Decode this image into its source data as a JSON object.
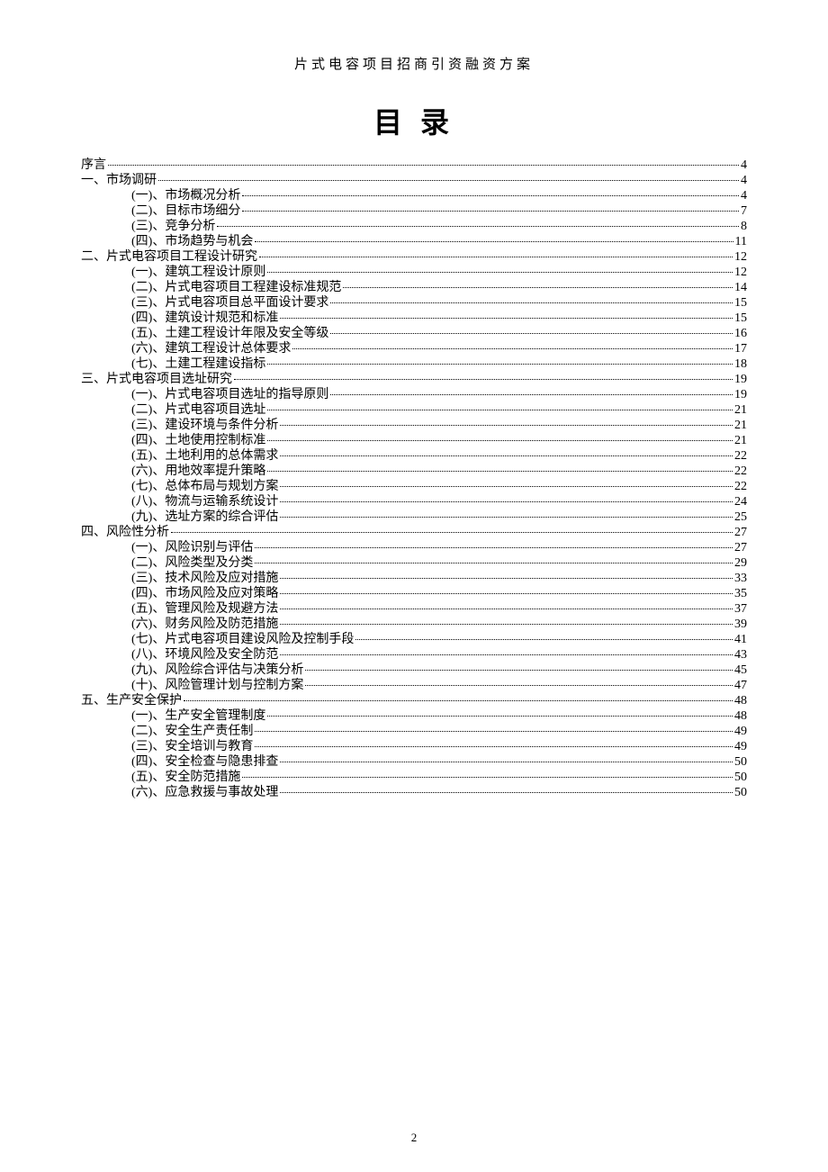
{
  "header": "片式电容项目招商引资融资方案",
  "title": "目 录",
  "page_number": "2",
  "toc": [
    {
      "level": 0,
      "label": "序言",
      "page": "4"
    },
    {
      "level": 1,
      "label": "一、市场调研",
      "page": "4"
    },
    {
      "level": 2,
      "label": "(一)、市场概况分析",
      "page": "4"
    },
    {
      "level": 2,
      "label": "(二)、目标市场细分",
      "page": "7"
    },
    {
      "level": 2,
      "label": "(三)、竞争分析",
      "page": "8"
    },
    {
      "level": 2,
      "label": "(四)、市场趋势与机会",
      "page": "11"
    },
    {
      "level": 1,
      "label": "二、片式电容项目工程设计研究",
      "page": "12"
    },
    {
      "level": 2,
      "label": "(一)、建筑工程设计原则",
      "page": "12"
    },
    {
      "level": 2,
      "label": "(二)、片式电容项目工程建设标准规范",
      "page": "14"
    },
    {
      "level": 2,
      "label": "(三)、片式电容项目总平面设计要求",
      "page": "15"
    },
    {
      "level": 2,
      "label": "(四)、建筑设计规范和标准",
      "page": "15"
    },
    {
      "level": 2,
      "label": "(五)、土建工程设计年限及安全等级",
      "page": "16"
    },
    {
      "level": 2,
      "label": "(六)、建筑工程设计总体要求",
      "page": "17"
    },
    {
      "level": 2,
      "label": "(七)、土建工程建设指标",
      "page": "18"
    },
    {
      "level": 1,
      "label": "三、片式电容项目选址研究",
      "page": "19"
    },
    {
      "level": 2,
      "label": "(一)、片式电容项目选址的指导原则",
      "page": "19"
    },
    {
      "level": 2,
      "label": "(二)、片式电容项目选址",
      "page": "21"
    },
    {
      "level": 2,
      "label": "(三)、建设环境与条件分析",
      "page": "21"
    },
    {
      "level": 2,
      "label": "(四)、土地使用控制标准",
      "page": "21"
    },
    {
      "level": 2,
      "label": "(五)、土地利用的总体需求",
      "page": "22"
    },
    {
      "level": 2,
      "label": "(六)、用地效率提升策略",
      "page": "22"
    },
    {
      "level": 2,
      "label": "(七)、总体布局与规划方案",
      "page": "22"
    },
    {
      "level": 2,
      "label": "(八)、物流与运输系统设计",
      "page": "24"
    },
    {
      "level": 2,
      "label": "(九)、选址方案的综合评估",
      "page": "25"
    },
    {
      "level": 1,
      "label": "四、风险性分析",
      "page": "27"
    },
    {
      "level": 2,
      "label": "(一)、风险识别与评估",
      "page": "27"
    },
    {
      "level": 2,
      "label": "(二)、风险类型及分类",
      "page": "29"
    },
    {
      "level": 2,
      "label": "(三)、技术风险及应对措施",
      "page": "33"
    },
    {
      "level": 2,
      "label": "(四)、市场风险及应对策略",
      "page": "35"
    },
    {
      "level": 2,
      "label": "(五)、管理风险及规避方法",
      "page": "37"
    },
    {
      "level": 2,
      "label": "(六)、财务风险及防范措施",
      "page": "39"
    },
    {
      "level": 2,
      "label": "(七)、片式电容项目建设风险及控制手段",
      "page": "41"
    },
    {
      "level": 2,
      "label": "(八)、环境风险及安全防范",
      "page": "43"
    },
    {
      "level": 2,
      "label": "(九)、风险综合评估与决策分析",
      "page": "45"
    },
    {
      "level": 2,
      "label": "(十)、风险管理计划与控制方案",
      "page": "47"
    },
    {
      "level": 1,
      "label": "五、生产安全保护",
      "page": "48"
    },
    {
      "level": 2,
      "label": "(一)、生产安全管理制度",
      "page": "48"
    },
    {
      "level": 2,
      "label": "(二)、安全生产责任制",
      "page": "49"
    },
    {
      "level": 2,
      "label": "(三)、安全培训与教育",
      "page": "49"
    },
    {
      "level": 2,
      "label": "(四)、安全检查与隐患排查",
      "page": "50"
    },
    {
      "level": 2,
      "label": "(五)、安全防范措施",
      "page": "50"
    },
    {
      "level": 2,
      "label": "(六)、应急救援与事故处理",
      "page": "50"
    }
  ]
}
